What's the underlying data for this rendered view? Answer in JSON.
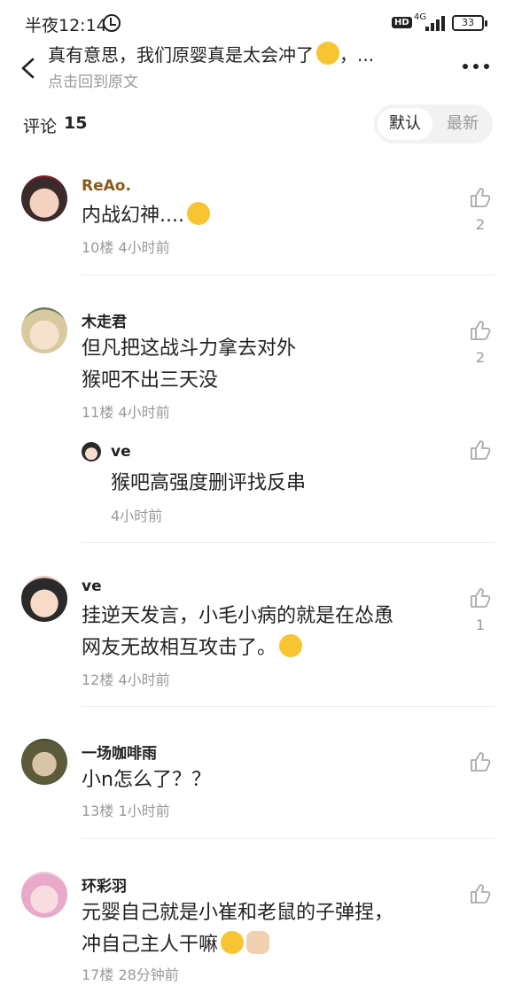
{
  "status_bar": {
    "time": "半夜12:14",
    "hd_label": "HD",
    "network_label": "4G",
    "battery": "33"
  },
  "header": {
    "title": "真有意思，我们原婴真是太会冲了",
    "title_suffix": "，...",
    "subtitle": "点击回到原文"
  },
  "comments_bar": {
    "label": "评论",
    "count": "15",
    "sort_default": "默认",
    "sort_latest": "最新"
  },
  "comments": [
    {
      "username": "ReAo.",
      "lines": [
        "内战幻神...."
      ],
      "meta": "10楼 4小时前",
      "likes": "2"
    },
    {
      "username": "木走君",
      "lines": [
        "但凡把这战斗力拿去对外",
        "猴吧不出三天没"
      ],
      "meta": "11楼 4小时前",
      "likes": "2",
      "reply": {
        "username": "ve",
        "text": "猴吧高强度删评找反串",
        "meta": "4小时前"
      }
    },
    {
      "username": "ve",
      "lines": [
        "挂逆天发言，小毛小病的就是在怂恿",
        "网友无故相互攻击了。"
      ],
      "meta": "12楼 4小时前",
      "likes": "1"
    },
    {
      "username": "一场咖啡雨",
      "lines": [
        "小n怎么了？？"
      ],
      "meta": "13楼 1小时前",
      "likes": ""
    },
    {
      "username": "环彩羽",
      "lines": [
        "元婴自己就是小崔和老鼠的子弹捏，",
        "冲自己主人干嘛"
      ],
      "meta": "17楼 28分钟前",
      "likes": ""
    }
  ],
  "icons": {
    "back": "back-arrow-icon",
    "more": "more-dots-icon",
    "like": "thumbs-up-icon",
    "alarm": "alarm-icon"
  },
  "colors": {
    "text": "#222222",
    "muted": "#999999",
    "username_highlight": "#8a5a1c"
  }
}
